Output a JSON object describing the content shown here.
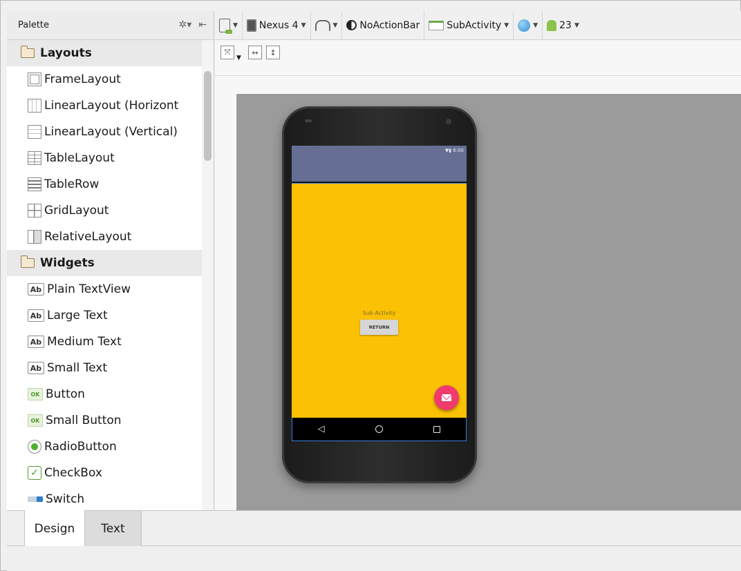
{
  "palette": {
    "title": "Palette",
    "categories": [
      {
        "label": "Layouts",
        "items": [
          {
            "label": "FrameLayout",
            "icon": "frame-layout-icon"
          },
          {
            "label": "LinearLayout (Horizont",
            "icon": "linear-horizontal-icon"
          },
          {
            "label": "LinearLayout (Vertical)",
            "icon": "linear-vertical-icon"
          },
          {
            "label": "TableLayout",
            "icon": "table-layout-icon"
          },
          {
            "label": "TableRow",
            "icon": "table-row-icon"
          },
          {
            "label": "GridLayout",
            "icon": "grid-layout-icon"
          },
          {
            "label": "RelativeLayout",
            "icon": "relative-layout-icon"
          }
        ]
      },
      {
        "label": "Widgets",
        "items": [
          {
            "label": "Plain TextView",
            "icon": "textview-icon",
            "glyph": "Ab"
          },
          {
            "label": "Large Text",
            "icon": "textview-icon",
            "glyph": "Ab"
          },
          {
            "label": "Medium Text",
            "icon": "textview-icon",
            "glyph": "Ab"
          },
          {
            "label": "Small Text",
            "icon": "textview-icon",
            "glyph": "Ab"
          },
          {
            "label": "Button",
            "icon": "button-icon",
            "glyph": "OK"
          },
          {
            "label": "Small Button",
            "icon": "button-icon",
            "glyph": "OK"
          },
          {
            "label": "RadioButton",
            "icon": "radio-icon"
          },
          {
            "label": "CheckBox",
            "icon": "checkbox-icon",
            "glyph": "✓"
          },
          {
            "label": "Switch",
            "icon": "switch-icon"
          }
        ]
      }
    ]
  },
  "toolbar": {
    "device": "Nexus 4",
    "theme": "NoActionBar",
    "activity": "SubActivity",
    "api": "23"
  },
  "preview": {
    "status_text": "▼▮ 6:00",
    "sub_label": "Sub Activity",
    "return_button": "RETURN",
    "colors": {
      "statusbar": "#666e94",
      "content": "#fbc104",
      "fab": "#ef3b6e"
    }
  },
  "tabs": {
    "design": "Design",
    "text": "Text"
  }
}
